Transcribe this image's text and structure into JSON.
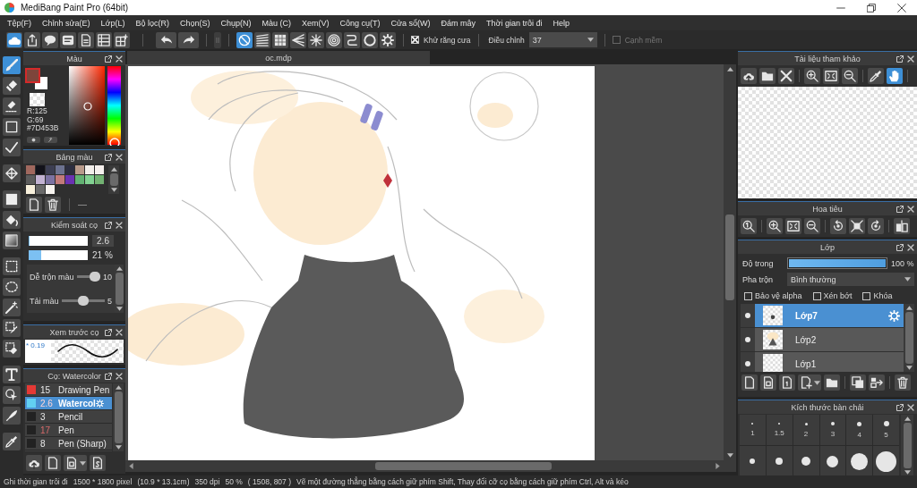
{
  "window": {
    "title": "MediBang Paint Pro (64bit)"
  },
  "menu": [
    "Tệp(F)",
    "Chỉnh sửa(E)",
    "Lớp(L)",
    "Bộ lọc(R)",
    "Chọn(S)",
    "Chụp(N)",
    "Màu (C)",
    "Xem(V)",
    "Công cụ(T)",
    "Cửa sổ(W)",
    "Đám mây",
    "Thời gian trôi đi",
    "Help"
  ],
  "toolbar": {
    "snap_buttons": [
      {
        "selected": true
      },
      {
        "selected": false
      },
      {
        "selected": false
      },
      {
        "selected": false
      },
      {
        "selected": false
      },
      {
        "selected": false
      },
      {
        "selected": false
      },
      {
        "selected": false
      },
      {
        "selected": false
      }
    ],
    "antialias": {
      "label": "Khử răng cưa",
      "checked": true
    },
    "correction": {
      "label": "Điều chỉnh",
      "value": "37"
    },
    "soft_edge": {
      "label": "Cạnh mềm",
      "checked": false,
      "disabled": true
    }
  },
  "tools": [
    {
      "selected": true
    },
    {
      "selected": false
    },
    {
      "selected": false
    },
    {
      "selected": false
    },
    {
      "selected": false
    },
    {
      "selected": false
    },
    {
      "selected": false
    },
    {
      "selected": false
    },
    {
      "selected": false
    },
    {
      "selected": false
    },
    {
      "selected": false
    },
    {
      "selected": false
    },
    {
      "selected": false
    },
    {
      "selected": false
    },
    {
      "selected": false
    },
    {
      "selected": false
    },
    {
      "selected": false
    },
    {
      "selected": false
    }
  ],
  "color_panel": {
    "title": "Màu",
    "swatches": [
      {
        "kind": "foreground",
        "color": "#7d453b"
      },
      {
        "kind": "background",
        "color": "#ffffff"
      }
    ],
    "readout": [
      "R:125",
      "G:69",
      "#7D453B"
    ]
  },
  "palette_panel": {
    "title": "Bảng màu",
    "swatches": [
      {
        "color": "#a0685e"
      },
      {
        "color": "#12121a"
      },
      {
        "color": "#3c3e52"
      },
      {
        "color": "#6c7290"
      },
      {
        "color": "#2c2e40"
      },
      {
        "color": "#b89a8a"
      },
      {
        "color": "#f2eeea"
      },
      {
        "color": "#f6f0ee"
      },
      {
        "color": "#5c5c5c"
      },
      {
        "color": "#c2b2d2"
      },
      {
        "color": "#7c72a2"
      },
      {
        "color": "#c27a7a"
      },
      {
        "color": "#6a32b2"
      },
      {
        "color": "#62b272"
      },
      {
        "color": "#82d292"
      },
      {
        "color": "#72b272"
      },
      {
        "color": "#f8f0dc"
      },
      {
        "color": "#6a6a6a"
      },
      {
        "color": "#f8f4f0"
      }
    ]
  },
  "brush_control": {
    "title": "Kiểm soát cọ",
    "size": {
      "level": 0.02,
      "value": "2.6"
    },
    "opacity": {
      "level": 0.21,
      "reading": "21 %"
    },
    "sliders": [
      {
        "label": "Dễ trộn màu",
        "level": 1,
        "reading": "10"
      },
      {
        "label": "Tải màu",
        "level": 0.5,
        "reading": "5"
      }
    ]
  },
  "brush_preview": {
    "title": "Xem trước cọ",
    "size_label": "* 0.19"
  },
  "brush_list": {
    "title": "Cọ: Watercolor",
    "brushes": [
      {
        "name": "Drawing Pen",
        "size": "15",
        "color": "#e53935",
        "size_highlighted": false,
        "selected": false
      },
      {
        "name": "Watercol",
        "size": "2.6",
        "color": "#62d0f2",
        "size_highlighted": true,
        "selected": true
      },
      {
        "name": "Pencil",
        "size": "3",
        "color": "#222222",
        "size_highlighted": false,
        "selected": false
      },
      {
        "name": "Pen",
        "size": "17",
        "color": "#222222",
        "size_highlighted": true,
        "selected": false
      },
      {
        "name": "Pen (Sharp)",
        "size": "8",
        "color": "#222222",
        "size_highlighted": false,
        "selected": false
      }
    ]
  },
  "canvas": {
    "tab": "oc.mdp"
  },
  "reference_panel": {
    "title": "Tài liệu tham khảo",
    "toggles": [
      {
        "selected": false
      },
      {
        "selected": true
      }
    ]
  },
  "navigator_panel": {
    "title": "Hoa tiêu"
  },
  "layers_panel": {
    "title": "Lớp",
    "opacity": {
      "label": "Độ trong",
      "level": 1,
      "reading": "100 %"
    },
    "blend": {
      "label": "Pha trộn",
      "value": "Bình thường"
    },
    "options": [
      {
        "label": "Bảo vệ alpha",
        "checked": false
      },
      {
        "label": "Xén bớt",
        "checked": false
      },
      {
        "label": "Khóa",
        "checked": false
      }
    ],
    "layers": [
      {
        "name": "Lớp7",
        "selected": true,
        "visible": true
      },
      {
        "name": "Lớp2",
        "selected": false,
        "visible": true
      },
      {
        "name": "Lớp1",
        "selected": false,
        "visible": true
      }
    ]
  },
  "brush_size_panel": {
    "title": "Kích thước bàn chải",
    "sizes": [
      "1",
      "1.5",
      "2",
      "3",
      "4",
      "5"
    ]
  },
  "status_bar": [
    "Ghi thời gian trôi đi",
    "1500 * 1800 pixel",
    "(10.9 * 13.1cm)",
    "350 dpi",
    "50 %",
    "( 1508, 807 )",
    "Vẽ một đường thẳng bằng cách giữ phím Shift, Thay đổi cỡ cọ bằng cách giữ phím Ctrl, Alt và kéo"
  ]
}
